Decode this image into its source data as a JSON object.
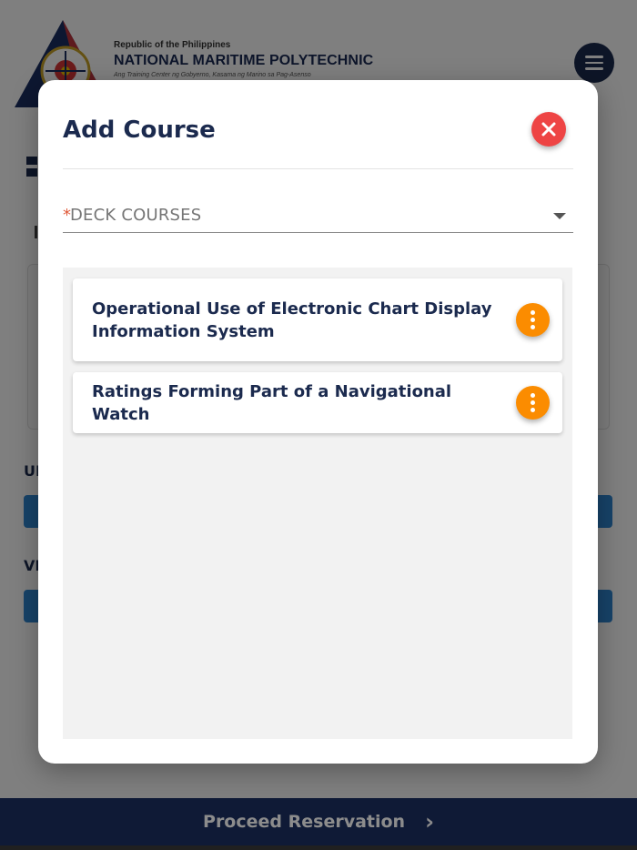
{
  "header": {
    "republic": "Republic of the Philippines",
    "institution": "NATIONAL MARITIME POLYTECHNIC",
    "tagline": "Ang Training Center ng Gobyerno, Kasama ng Marino sa Pag-Asenso",
    "menu_icon": "hamburger-menu-icon"
  },
  "background": {
    "label_1": "UI",
    "label_2": "VI"
  },
  "modal": {
    "title": "Add Course",
    "close_icon": "close-x-icon",
    "select": {
      "required_marker": "*",
      "value": "DECK COURSES",
      "caret_icon": "caret-down-icon"
    },
    "courses": [
      {
        "title": "Operational Use of Electronic Chart Display Information System"
      },
      {
        "title": "Ratings Forming Part of a Navigational Watch"
      }
    ],
    "more_icon": "more-vertical-icon"
  },
  "footer": {
    "proceed_label": "Proceed Reservation",
    "chevron_icon": "chevron-right-icon"
  },
  "colors": {
    "navy": "#1b2a4e",
    "footer": "#1b2f63",
    "close": "#ee4444",
    "more": "#fb8c00",
    "bar": "#2f86d3"
  }
}
